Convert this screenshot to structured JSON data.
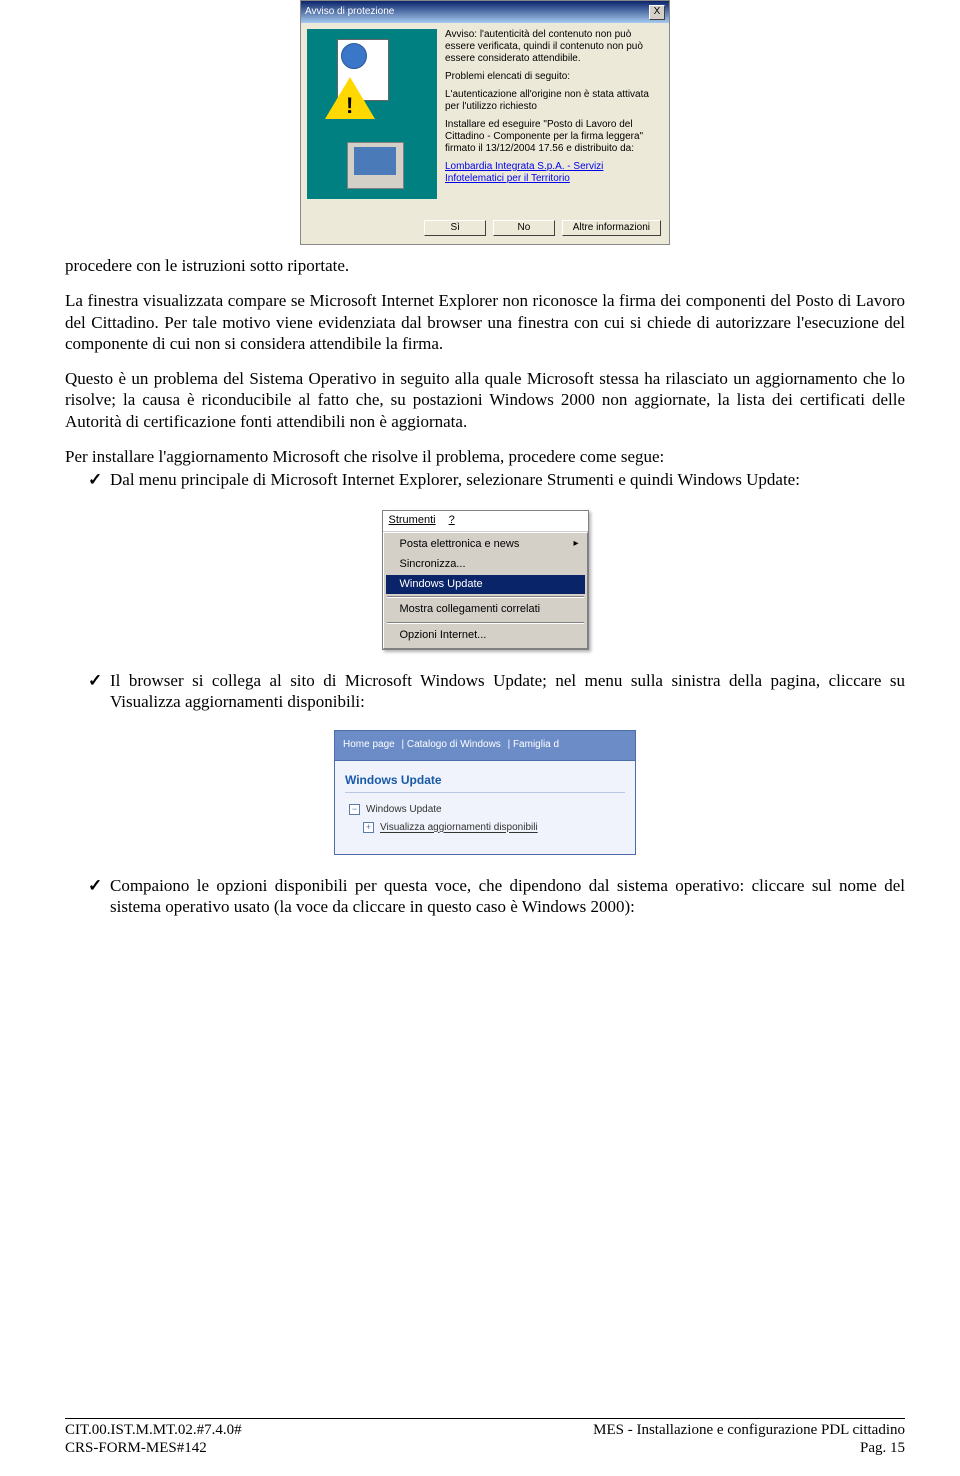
{
  "dialog": {
    "title": "Avviso di protezione",
    "close": "X",
    "para1": "Avviso: l'autenticità del contenuto non può essere verificata, quindi il contenuto non può essere considerato attendibile.",
    "para2": "Problemi elencati di seguito:",
    "para3": "L'autenticazione all'origine non è stata attivata per l'utilizzo richiesto",
    "para4": "Installare ed eseguire \"Posto di Lavoro del Cittadino - Componente per la firma leggera\" firmato il 13/12/2004 17.56 e distribuito da:",
    "link": "Lombardia Integrata S.p.A. - Servizi Infotelematici per il Territorio",
    "btn_si": "Sì",
    "btn_no": "No",
    "btn_altre": "Altre informazioni"
  },
  "text": {
    "p1": "procedere con le istruzioni sotto riportate.",
    "p2": "La finestra visualizzata compare se Microsoft Internet Explorer non riconosce la firma dei componenti del Posto di Lavoro del Cittadino. Per tale motivo viene evidenziata dal browser una finestra con cui si chiede di autorizzare l'esecuzione del componente di cui non si considera attendibile la firma.",
    "p3": "Questo è un problema del Sistema Operativo in seguito alla quale Microsoft stessa ha rilasciato un aggiornamento che lo risolve; la causa è riconducibile al fatto che, su postazioni Windows 2000 non aggiornate, la lista dei certificati delle Autorità di certificazione fonti attendibili non è aggiornata.",
    "p4": "Per installare l'aggiornamento Microsoft che risolve il problema, procedere come segue:",
    "b1": "Dal menu principale di Microsoft Internet Explorer, selezionare Strumenti e quindi Windows Update:",
    "b2": "Il browser si collega al sito di Microsoft Windows Update; nel menu sulla sinistra della pagina, cliccare su Visualizza aggiornamenti disponibili:",
    "b3": "Compaiono le opzioni disponibili per questa voce, che dipendono dal sistema operativo: cliccare sul nome del sistema operativo usato (la voce da cliccare in questo caso è Windows 2000):"
  },
  "menu": {
    "bar1": "Strumenti",
    "bar2": "?",
    "i1": "Posta elettronica e news",
    "i2": "Sincronizza...",
    "i3": "Windows Update",
    "i4": "Mostra collegamenti correlati",
    "i5": "Opzioni Internet..."
  },
  "wu": {
    "nav1": "Home page",
    "nav2": "Catalogo di Windows",
    "nav3": "Famiglia d",
    "head": "Windows Update",
    "item1": "Windows Update",
    "item2": "Visualizza aggiornamenti disponibili"
  },
  "footer": {
    "left1": "CIT.00.IST.M.MT.02.#7.4.0#",
    "left2": "CRS-FORM-MES#142",
    "right1": "MES - Installazione e configurazione PDL cittadino",
    "right2": "Pag. 15"
  }
}
